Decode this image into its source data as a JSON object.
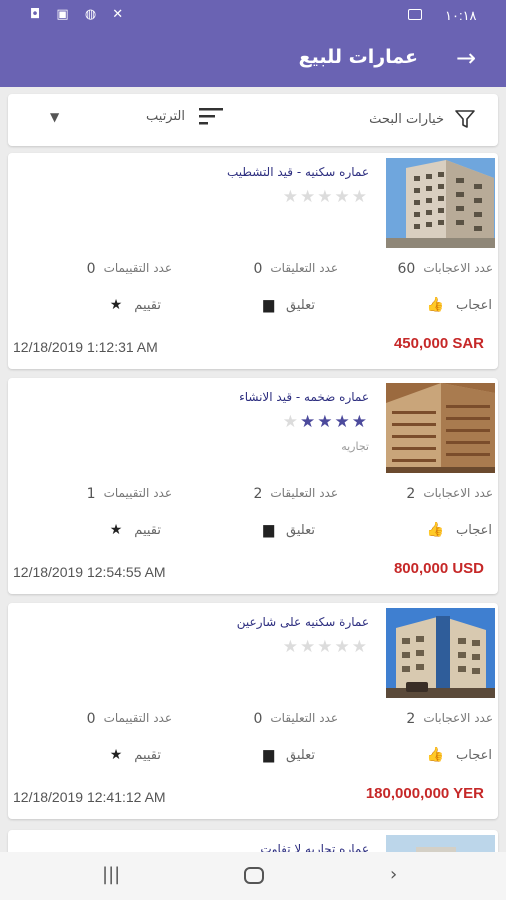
{
  "status": {
    "time": "١٠:١٨",
    "icons": "◘ ▣ ◍ ✕"
  },
  "appbar": {
    "title": "عمارات للبيع",
    "back_icon": "arrow-right-icon"
  },
  "filter": {
    "search_label": "خيارات البحث",
    "sort_label": "الترتيب"
  },
  "labels": {
    "likes_count": "عدد الاعجابات",
    "comments_count": "عدد التعليقات",
    "ratings_count": "عدد التقييمات",
    "like": "اعجاب",
    "comment": "تعليق",
    "rate": "تقييم"
  },
  "cards": [
    {
      "name": "عماره سكنيه - قيد التشطيب",
      "rating": 0,
      "type": "",
      "likes": "60",
      "comments": "0",
      "ratings": "0",
      "price": "450,000 SAR",
      "date": "12/18/2019 1:12:31 AM"
    },
    {
      "name": "عماره ضخمه - قيد الانشاء",
      "rating": 4,
      "type": "تجاريه",
      "likes": "2",
      "comments": "2",
      "ratings": "1",
      "price": "800,000 USD",
      "date": "12/18/2019 12:54:55 AM"
    },
    {
      "name": "عمارة سكنيه على شارعين",
      "rating": 0,
      "type": "",
      "likes": "2",
      "comments": "0",
      "ratings": "0",
      "price": "180,000,000 YER",
      "date": "12/18/2019 12:41:12 AM"
    },
    {
      "name": "عماره تجاريه لا تفاوت"
    }
  ],
  "colors": {
    "primary": "#6a63b3",
    "price": "#c62828",
    "star_on": "#4c4a9c",
    "star_off": "#dcdcdc",
    "name": "#2e2f80"
  }
}
